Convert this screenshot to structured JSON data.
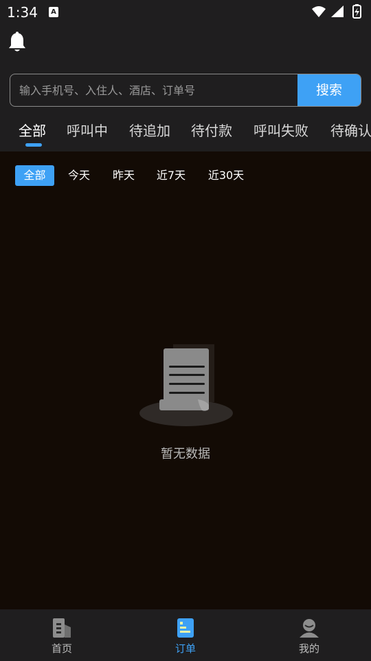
{
  "status_bar": {
    "time": "1:34",
    "notification_icon": "A"
  },
  "search": {
    "placeholder": "输入手机号、入住人、酒店、订单号",
    "button_label": "搜索"
  },
  "tabs": [
    {
      "label": "全部",
      "active": true
    },
    {
      "label": "呼叫中",
      "active": false
    },
    {
      "label": "待追加",
      "active": false
    },
    {
      "label": "待付款",
      "active": false
    },
    {
      "label": "呼叫失败",
      "active": false
    },
    {
      "label": "待确认",
      "active": false
    }
  ],
  "filters": [
    {
      "label": "全部",
      "active": true
    },
    {
      "label": "今天",
      "active": false
    },
    {
      "label": "昨天",
      "active": false
    },
    {
      "label": "近7天",
      "active": false
    },
    {
      "label": "近30天",
      "active": false
    }
  ],
  "empty_state": {
    "text": "暂无数据"
  },
  "bottom_nav": [
    {
      "label": "首页",
      "icon": "home-building-icon",
      "active": false
    },
    {
      "label": "订单",
      "icon": "order-icon",
      "active": true
    },
    {
      "label": "我的",
      "icon": "profile-icon",
      "active": false
    }
  ],
  "colors": {
    "accent": "#3ea1f5",
    "header_bg": "#1f1e1f",
    "content_bg": "#130b05"
  }
}
